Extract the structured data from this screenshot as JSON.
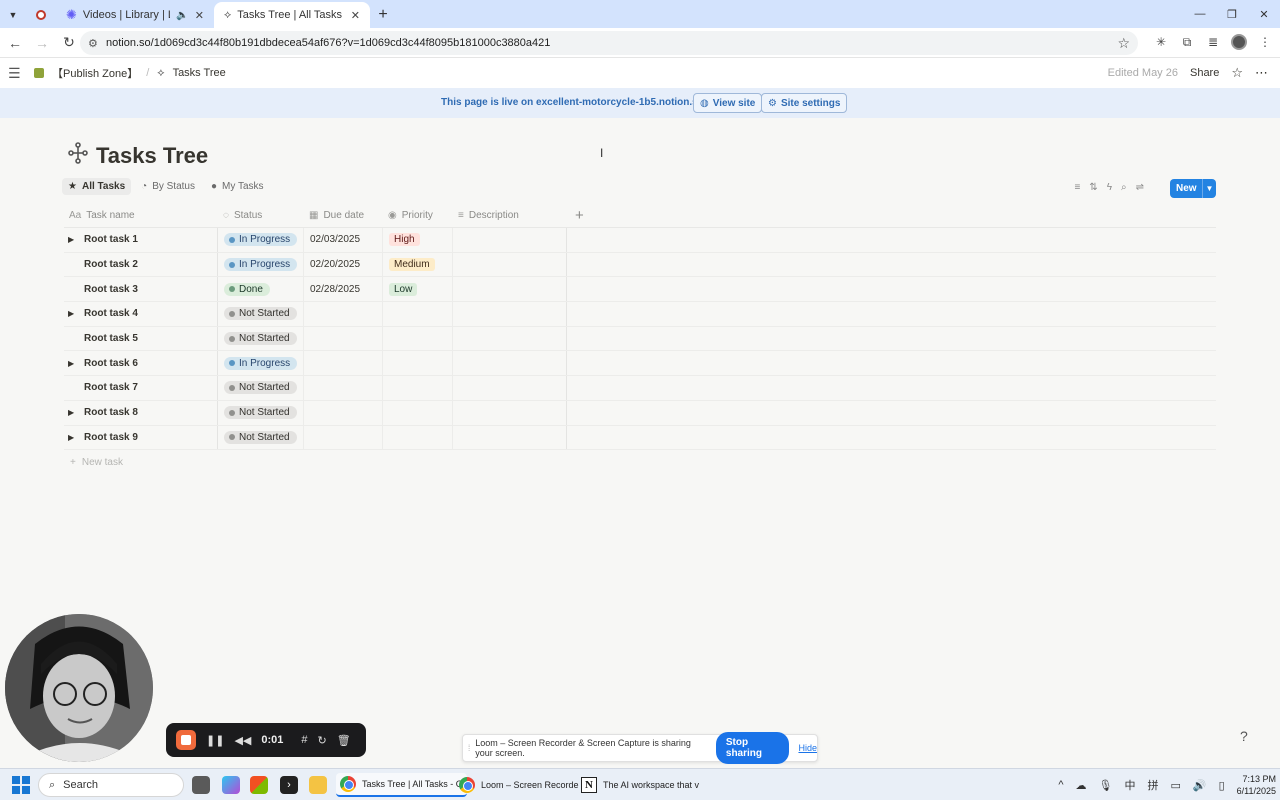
{
  "browser": {
    "tabs": [
      {
        "title": "",
        "pinned": true
      },
      {
        "title": "Videos | Library | Loom",
        "audio": true
      },
      {
        "title": "Tasks Tree | All Tasks",
        "active": true
      }
    ],
    "url": "notion.so/1d069cd3c44f80b191dbdecea54af676?v=1d069cd3c44f8095b181000c3880a421"
  },
  "notion": {
    "workspace": "【Publish Zone】",
    "page_crumb": "Tasks Tree",
    "edited": "Edited May 26",
    "share_label": "Share"
  },
  "banner": {
    "message": "This page is live on excellent-motorcycle-1b5.notion.site",
    "view_site": "View site",
    "site_settings": "Site settings"
  },
  "page": {
    "title": "Tasks Tree",
    "views": [
      {
        "label": "All Tasks",
        "icon": "star-icon",
        "active": true
      },
      {
        "label": "By Status",
        "icon": "status-icon"
      },
      {
        "label": "My Tasks",
        "icon": "person-icon"
      }
    ],
    "new_button": "New",
    "new_task": "New task"
  },
  "table": {
    "columns": [
      "Task name",
      "Status",
      "Due date",
      "Priority",
      "Description"
    ],
    "column_icons": [
      "Aa",
      "◌",
      "▦",
      "◉",
      "≡"
    ],
    "rows": [
      {
        "name": "Root task 1",
        "toggle": true,
        "status": "In Progress",
        "due": "02/03/2025",
        "priority": "High"
      },
      {
        "name": "Root task 2",
        "toggle": false,
        "status": "In Progress",
        "due": "02/20/2025",
        "priority": "Medium"
      },
      {
        "name": "Root task 3",
        "toggle": false,
        "status": "Done",
        "due": "02/28/2025",
        "priority": "Low"
      },
      {
        "name": "Root task 4",
        "toggle": true,
        "status": "Not Started",
        "due": "",
        "priority": ""
      },
      {
        "name": "Root task 5",
        "toggle": false,
        "status": "Not Started",
        "due": "",
        "priority": ""
      },
      {
        "name": "Root task 6",
        "toggle": true,
        "status": "In Progress",
        "due": "",
        "priority": ""
      },
      {
        "name": "Root task 7",
        "toggle": false,
        "status": "Not Started",
        "due": "",
        "priority": ""
      },
      {
        "name": "Root task 8",
        "toggle": true,
        "status": "Not Started",
        "due": "",
        "priority": ""
      },
      {
        "name": "Root task 9",
        "toggle": true,
        "status": "Not Started",
        "due": "",
        "priority": ""
      }
    ]
  },
  "status_colors": {
    "In Progress": {
      "bg": "#d3e5ef",
      "dot": "#5a96c3",
      "fg": "#28456c"
    },
    "Done": {
      "bg": "#dbeddb",
      "dot": "#6c9b7d",
      "fg": "#1c3829"
    },
    "Not Started": {
      "bg": "#e3e2e0",
      "dot": "#91918e",
      "fg": "#32302c"
    }
  },
  "priority_colors": {
    "High": {
      "bg": "#ffe2dd",
      "fg": "#5d1715"
    },
    "Medium": {
      "bg": "#fdecc8",
      "fg": "#402c1b"
    },
    "Low": {
      "bg": "#dbeddb",
      "fg": "#1c3829"
    }
  },
  "loom": {
    "timer": "0:01",
    "share_message": "Loom – Screen Recorder & Screen Capture is sharing your screen.",
    "stop_sharing": "Stop sharing",
    "hide": "Hide"
  },
  "taskbar": {
    "search_label": "Search",
    "apps": [
      {
        "label": "Tasks Tree | All Tasks - G"
      },
      {
        "label": "Loom – Screen Recorde"
      },
      {
        "label": "The AI workspace that v"
      }
    ],
    "time": "7:13 PM",
    "date": "6/11/2025",
    "ime": "中",
    "ime2": "拼"
  }
}
